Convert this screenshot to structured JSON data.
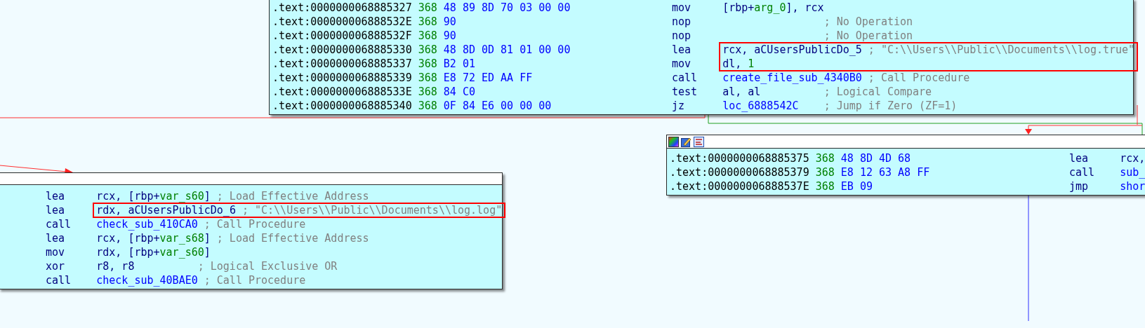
{
  "blocks": [
    {
      "kind": "plain",
      "rows": [
        {
          "address": ".text:0000000068885327",
          "stack": "368",
          "bytes": "48 89 8D 70 03 00 00",
          "mnemonic": "mov",
          "operand": [
            {
              "text": "[rbp+",
              "kind": "reg"
            },
            {
              "text": "arg_0",
              "kind": "var"
            },
            {
              "text": "], rcx",
              "kind": "reg"
            }
          ],
          "highlighted": false
        },
        {
          "address": ".text:000000006888532E",
          "stack": "368",
          "bytes": "90",
          "mnemonic": "nop",
          "operand": [],
          "comment": "; No Operation",
          "highlighted": false
        },
        {
          "address": ".text:000000006888532F",
          "stack": "368",
          "bytes": "90",
          "mnemonic": "nop",
          "operand": [],
          "comment": "; No Operation",
          "highlighted": false
        },
        {
          "address": ".text:0000000068885330",
          "stack": "368",
          "bytes": "48 8D 0D 81 01 00 00",
          "mnemonic": "lea",
          "operand": [
            {
              "text": "rcx, aCUsersPublicDo_5",
              "kind": "reg"
            }
          ],
          "comment": "; \"C:\\\\Users\\\\Public\\\\Documents\\\\log.true\"",
          "highlighted": true
        },
        {
          "address": ".text:0000000068885337",
          "stack": "368",
          "bytes": "B2 01",
          "mnemonic": "mov",
          "operand": [
            {
              "text": "dl, ",
              "kind": "reg"
            },
            {
              "text": "1",
              "kind": "num"
            }
          ],
          "highlighted": true
        },
        {
          "address": ".text:0000000068885339",
          "stack": "368",
          "bytes": "E8 72 ED AA FF",
          "mnemonic": "call",
          "operand": [
            {
              "text": "create_file_sub_4340B0",
              "kind": "name"
            }
          ],
          "comment": "; Call Procedure",
          "highlighted": false
        },
        {
          "address": ".text:000000006888533E",
          "stack": "368",
          "bytes": "84 C0",
          "mnemonic": "test",
          "operand": [
            {
              "text": "al, al",
              "kind": "reg"
            }
          ],
          "comment": "; Logical Compare",
          "highlighted": false
        },
        {
          "address": ".text:0000000068885340",
          "stack": "368",
          "bytes": "0F 84 E6 00 00 00",
          "mnemonic": "jz",
          "operand": [
            {
              "text": "loc_6888542C",
              "kind": "name"
            }
          ],
          "comment": "; Jump if Zero (ZF=1)",
          "highlighted": false
        }
      ]
    },
    {
      "kind": "titled",
      "rows": [
        {
          "mnemonic": "lea",
          "operand": [
            {
              "text": "rcx, [rbp+",
              "kind": "reg"
            },
            {
              "text": "var_s60",
              "kind": "var"
            },
            {
              "text": "]",
              "kind": "reg"
            }
          ],
          "comment": "; Load Effective Address",
          "highlighted": false
        },
        {
          "mnemonic": "lea",
          "operand": [
            {
              "text": "rdx, ",
              "kind": "reg"
            },
            {
              "text": "aCUsersPublicDo_6",
              "kind": "reg"
            }
          ],
          "comment": "; \"C:\\\\Users\\\\Public\\\\Documents\\\\log.log\"",
          "highlighted": true
        },
        {
          "mnemonic": "call",
          "operand": [
            {
              "text": "check_sub_410CA0",
              "kind": "name"
            }
          ],
          "comment": "; Call Procedure",
          "highlighted": false
        },
        {
          "mnemonic": "lea",
          "operand": [
            {
              "text": "rcx, [rbp+",
              "kind": "reg"
            },
            {
              "text": "var_s68",
              "kind": "var"
            },
            {
              "text": "]",
              "kind": "reg"
            }
          ],
          "comment": "; Load Effective Address",
          "highlighted": false
        },
        {
          "mnemonic": "mov",
          "operand": [
            {
              "text": "rdx, [rbp+",
              "kind": "reg"
            },
            {
              "text": "var_s60",
              "kind": "var"
            },
            {
              "text": "]",
              "kind": "reg"
            }
          ],
          "highlighted": false
        },
        {
          "mnemonic": "xor",
          "operand": [
            {
              "text": "r8, r8",
              "kind": "reg"
            }
          ],
          "comment": "; Logical Exclusive OR",
          "highlighted": false
        },
        {
          "mnemonic": "call",
          "operand": [
            {
              "text": "check_sub_40BAE0",
              "kind": "name"
            }
          ],
          "comment": "; Call Procedure",
          "highlighted": false
        }
      ]
    },
    {
      "kind": "toolbar",
      "rows": [
        {
          "address": ".text:0000000068885375",
          "stack": "368",
          "bytes": "48 8D 4D 68",
          "mnemonic": "lea",
          "operand": [
            {
              "text": "rcx,",
              "kind": "reg"
            }
          ],
          "highlighted": false
        },
        {
          "address": ".text:0000000068885379",
          "stack": "368",
          "bytes": "E8 12 63 A8 FF",
          "mnemonic": "call",
          "operand": [
            {
              "text": "sub_",
              "kind": "name"
            }
          ],
          "highlighted": false
        },
        {
          "address": ".text:000000006888537E",
          "stack": "368",
          "bytes": "EB 09",
          "mnemonic": "jmp",
          "operand": [
            {
              "text": "shor",
              "kind": "name"
            }
          ],
          "highlighted": false
        }
      ]
    }
  ]
}
